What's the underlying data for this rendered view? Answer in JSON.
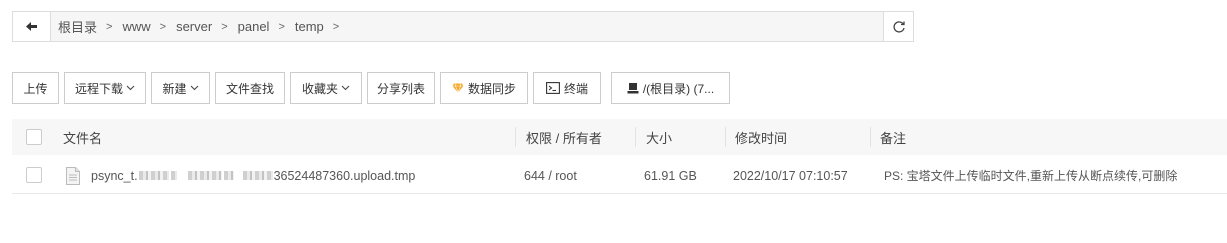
{
  "path": {
    "back_icon": "arrow-left-icon",
    "crumbs": [
      "根目录",
      "www",
      "server",
      "panel",
      "temp"
    ],
    "separator": ">",
    "refresh_icon": "refresh-icon"
  },
  "toolbar": {
    "upload": "上传",
    "remote_download": "远程下载",
    "new": "新建",
    "file_search": "文件查找",
    "favorites": "收藏夹",
    "share_list": "分享列表",
    "data_sync": "数据同步",
    "terminal": "终端",
    "disk": "/(根目录) (7..."
  },
  "table": {
    "headers": {
      "name": "文件名",
      "permission": "权限 / 所有者",
      "size": "大小",
      "modified": "修改时间",
      "remark": "备注"
    },
    "rows": [
      {
        "name_prefix": "psync_t.",
        "name_suffix": "36524487360.upload.tmp",
        "permission": "644 / root",
        "size": "61.91 GB",
        "modified": "2022/10/17 07:10:57",
        "remark": "PS: 宝塔文件上传临时文件,重新上传从断点续传,可删除"
      }
    ]
  },
  "colors": {
    "accent_sync": "#f5a623",
    "border": "#dddddd"
  }
}
